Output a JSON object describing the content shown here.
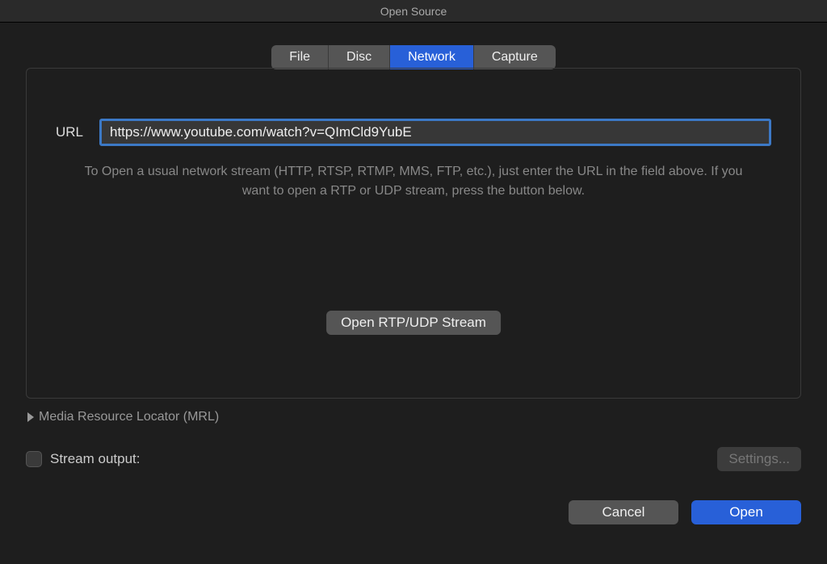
{
  "window": {
    "title": "Open Source"
  },
  "tabs": {
    "file": "File",
    "disc": "Disc",
    "network": "Network",
    "capture": "Capture",
    "active": "network"
  },
  "url": {
    "label": "URL",
    "value": "https://www.youtube.com/watch?v=QImCld9YubE"
  },
  "help_text": "To Open a usual network stream (HTTP, RTSP, RTMP, MMS, FTP, etc.), just enter the URL in the field above. If you want to open a RTP or UDP stream, press the button below.",
  "rtp_button": "Open RTP/UDP Stream",
  "mrl": {
    "label": "Media Resource Locator (MRL)"
  },
  "stream_output": {
    "label": "Stream output:",
    "settings": "Settings..."
  },
  "footer": {
    "cancel": "Cancel",
    "open": "Open"
  }
}
